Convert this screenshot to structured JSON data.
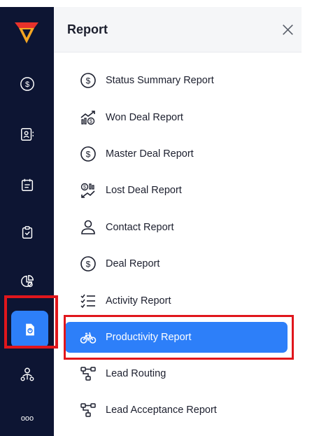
{
  "sidebar": {
    "icons": [
      "logo-icon",
      "dollar-icon",
      "contacts-icon",
      "calendar-icon",
      "clipboard-check-icon",
      "pie-chart-icon",
      "report-icon",
      "user-network-icon",
      "more-icon"
    ],
    "active": "report-icon",
    "more_label": "ooo"
  },
  "panel": {
    "title": "Report",
    "close_icon": "close-icon"
  },
  "menu": {
    "items": [
      {
        "label": "Status Summary Report",
        "icon": "dollar-circle-icon"
      },
      {
        "label": "Won Deal Report",
        "icon": "trending-up-dollar-icon"
      },
      {
        "label": "Master Deal Report",
        "icon": "dollar-circle-icon"
      },
      {
        "label": "Lost Deal Report",
        "icon": "trending-down-dollar-icon"
      },
      {
        "label": "Contact Report",
        "icon": "user-icon"
      },
      {
        "label": "Deal Report",
        "icon": "dollar-circle-icon"
      },
      {
        "label": "Activity Report",
        "icon": "checklist-icon"
      },
      {
        "label": "Productivity Report",
        "icon": "bicycle-icon"
      },
      {
        "label": "Lead Routing",
        "icon": "flow-icon"
      },
      {
        "label": "Lead Acceptance Report",
        "icon": "flow-icon"
      }
    ],
    "active_index": 7
  },
  "colors": {
    "sidebar_bg": "#0d1533",
    "accent": "#2d7ff9",
    "highlight": "#e0161c",
    "logo_orange": "#f5a623",
    "logo_red": "#e8322b"
  }
}
